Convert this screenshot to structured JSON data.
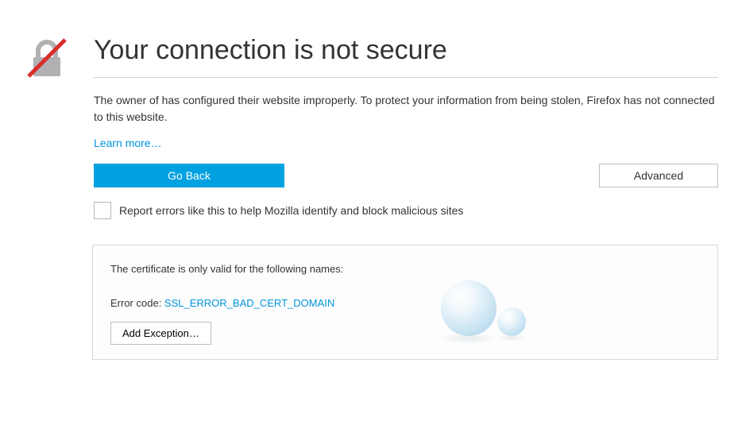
{
  "header": {
    "title": "Your connection is not secure"
  },
  "body": {
    "description_prefix": "The owner of ",
    "description_domain": "",
    "description_suffix": " has configured their website improperly. To protect your information from being stolen, Firefox has not connected to this website.",
    "learn_more": "Learn more…"
  },
  "buttons": {
    "go_back": "Go Back",
    "advanced": "Advanced",
    "add_exception": "Add Exception…"
  },
  "report": {
    "label": "Report errors like this to help Mozilla identify and block malicious sites"
  },
  "details": {
    "cert_line": "The certificate is only valid for the following names:",
    "error_label": "Error code: ",
    "error_code": "SSL_ERROR_BAD_CERT_DOMAIN"
  }
}
